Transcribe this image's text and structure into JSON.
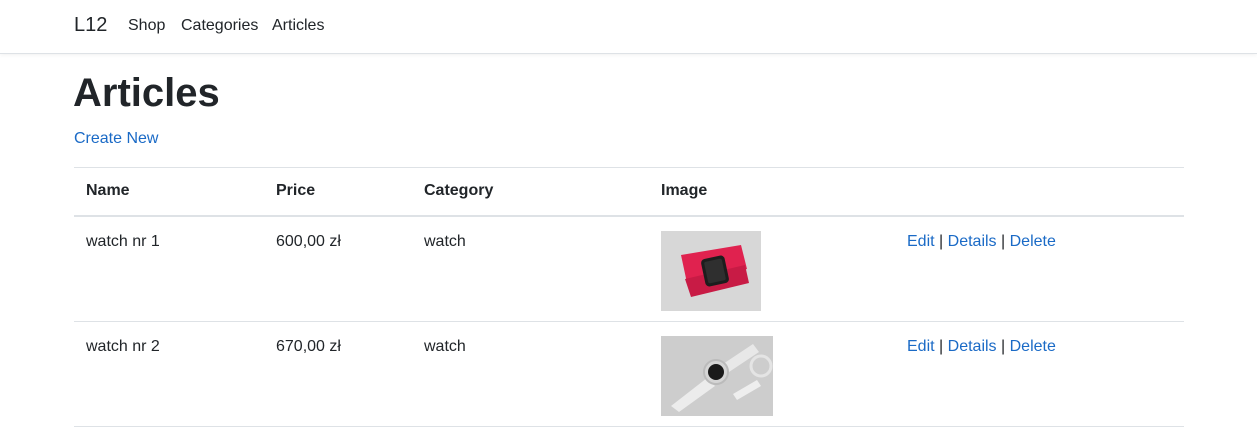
{
  "nav": {
    "brand": "L12",
    "links": [
      "Shop",
      "Categories",
      "Articles"
    ]
  },
  "page": {
    "title": "Articles",
    "create_label": "Create New"
  },
  "table": {
    "headers": [
      "Name",
      "Price",
      "Category",
      "Image",
      ""
    ],
    "rows": [
      {
        "name": "watch nr 1",
        "price": "600,00 zł",
        "category": "watch",
        "image": "watch-red-strap-image"
      },
      {
        "name": "watch nr 2",
        "price": "670,00 zł",
        "category": "watch",
        "image": "watch-white-strap-image"
      }
    ],
    "actions": {
      "edit": "Edit",
      "details": "Details",
      "delete": "Delete",
      "separator": "|"
    }
  },
  "colors": {
    "link": "#1a6ac6",
    "text": "#212529",
    "border": "#dee2e6"
  }
}
